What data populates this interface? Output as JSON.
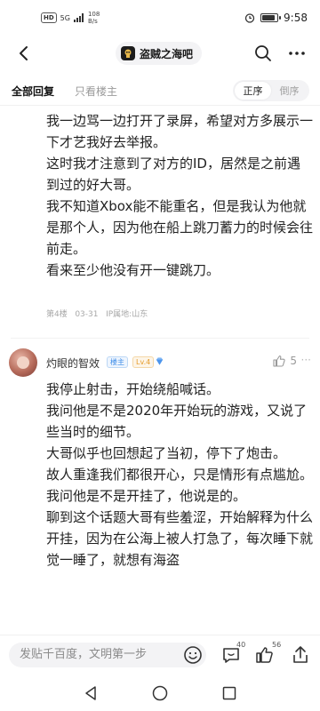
{
  "status_bar": {
    "hd": "HD",
    "signal": "5G",
    "net_speed_value": "108",
    "net_speed_unit": "B/s",
    "battery_percent": "80",
    "battery_level": 0.8,
    "time": "9:58"
  },
  "header": {
    "forum_name": "盗贼之海吧"
  },
  "tabs": {
    "all_replies": "全部回复",
    "op_only": "只看楼主",
    "sort_asc": "正序",
    "sort_desc": "倒序"
  },
  "post1": {
    "paragraphs": [
      "我一边骂一边打开了录屏，希望对方多展示一下才艺我好去举报。",
      "这时我才注意到了对方的ID，居然是之前遇到过的好大哥。",
      "我不知道Xbox能不能重名，但是我认为他就是那个人，因为他在船上跳刀蓄力的时候会往前走。",
      "看来至少他没有开一键跳刀。"
    ],
    "floor": "第4楼",
    "date": "03-31",
    "ip": "IP属地:山东"
  },
  "post2": {
    "username": "灼眼的智效",
    "op_badge": "楼主",
    "level_badge": "Lv.4",
    "like_count": "5",
    "paragraphs": [
      "我停止射击，开始绕船喊话。",
      "我问他是不是2020年开始玩的游戏，又说了些当时的细节。",
      "大哥似乎也回想起了当初，停下了炮击。",
      "故人重逢我们都很开心，只是情形有点尴尬。我问他是不是开挂了，他说是的。",
      "聊到这个话题大哥有些羞涩，开始解释为什么开挂，因为在公海上被人打急了，每次睡下就觉一睡了，就想有海盗"
    ]
  },
  "reply_bar": {
    "placeholder": "发贴千百度，文明第一步",
    "comment_count": "40",
    "like_count": "56"
  },
  "colors": {
    "accent_blue": "#3f8ee8",
    "level_orange": "#e59c2b",
    "text_primary": "#222222",
    "text_secondary": "#9a9a9a"
  }
}
